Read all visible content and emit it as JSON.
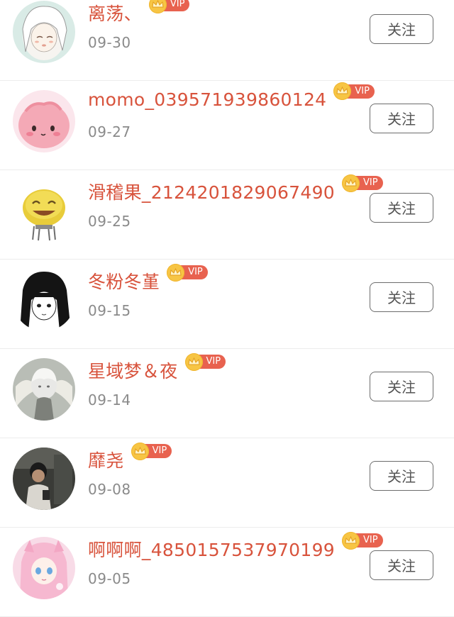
{
  "follow_list": [
    {
      "name": "离荡、",
      "date": "09-30",
      "vip_label": "VIP",
      "button_label": "关注",
      "avatar": "avatar-anime-girl-white-hair"
    },
    {
      "name": "momo_039571939860124",
      "date": "09-27",
      "vip_label": "VIP",
      "button_label": "关注",
      "avatar": "avatar-pink-blob"
    },
    {
      "name": "滑稽果_2124201829067490",
      "date": "09-25",
      "vip_label": "VIP",
      "button_label": "关注",
      "avatar": "avatar-laughing-emoji"
    },
    {
      "name": "冬粉冬堇",
      "date": "09-15",
      "vip_label": "VIP",
      "button_label": "关注",
      "avatar": "avatar-black-hair-girl"
    },
    {
      "name": "星域梦＆夜",
      "date": "09-14",
      "vip_label": "VIP",
      "button_label": "关注",
      "avatar": "avatar-winged-boy"
    },
    {
      "name": "靡尧",
      "date": "09-08",
      "vip_label": "VIP",
      "button_label": "关注",
      "avatar": "avatar-person-photo"
    },
    {
      "name": "啊啊啊_4850157537970199",
      "date": "09-05",
      "vip_label": "VIP",
      "button_label": "关注",
      "avatar": "avatar-pink-anime-girl"
    }
  ],
  "colors": {
    "name": "#d8533c",
    "date": "#8a8a8a",
    "vip_badge": "#e8624f",
    "vip_crown": "#f7c544",
    "button_border": "#6c6c6c"
  }
}
